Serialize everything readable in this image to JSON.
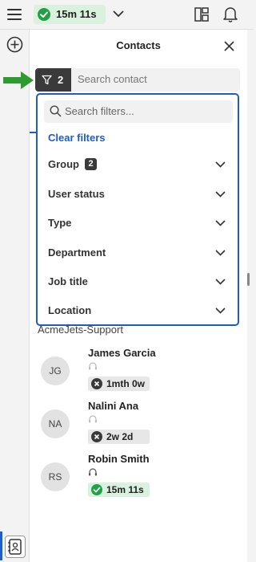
{
  "topbar": {
    "status_time": "15m 11s",
    "status_color": "#22a045"
  },
  "panel": {
    "title": "Contacts",
    "search_placeholder": "Search contact",
    "filter_count": "2"
  },
  "filters": {
    "search_placeholder": "Search filters...",
    "clear_label": "Clear filters",
    "items": [
      {
        "label": "Group",
        "badge": "2"
      },
      {
        "label": "User status"
      },
      {
        "label": "Type"
      },
      {
        "label": "Department"
      },
      {
        "label": "Job title"
      },
      {
        "label": "Location"
      }
    ]
  },
  "group": {
    "name": "AcmeJets-Support"
  },
  "contacts": [
    {
      "initials": "JG",
      "name": "James Garcia",
      "status": "1mth 0w",
      "state": "away"
    },
    {
      "initials": "NA",
      "name": "Nalini Ana",
      "status": "2w 2d",
      "state": "away"
    },
    {
      "initials": "RS",
      "name": "Robin Smith",
      "status": "15m 11s",
      "state": "available"
    }
  ],
  "colors": {
    "accent": "#1f5cc7",
    "available": "#22a045",
    "away": "#3a3a3a",
    "arrow": "#2e9b2e"
  }
}
